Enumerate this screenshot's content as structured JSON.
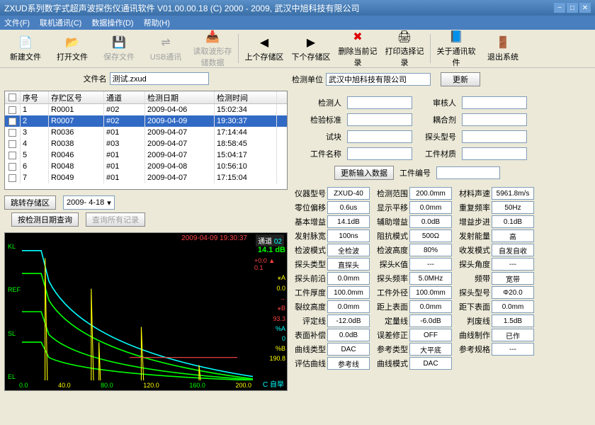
{
  "title": "ZXUD系列数字式超声波探伤仪通讯软件 V01.00.00.18 (C) 2000 - 2009, 武汉中旭科技有限公司",
  "menu": {
    "file": "文件(F)",
    "comm": "联机通讯(C)",
    "data": "数据操作(D)",
    "help": "帮助(H)"
  },
  "toolbar": {
    "new": "新建文件",
    "open": "打开文件",
    "save": "保存文件",
    "usb": "USB通讯",
    "read": "读取波形存储数据",
    "prev": "上个存储区",
    "next": "下个存储区",
    "delete": "删除当前记录",
    "print": "打印选择记录",
    "about": "关于通讯软件",
    "exit": "退出系统"
  },
  "file": {
    "label": "文件名",
    "value": "测试.zxud"
  },
  "unit": {
    "label": "检测单位",
    "value": "武汉中旭科技有限公司",
    "update": "更新"
  },
  "table": {
    "headers": [
      "",
      "序号",
      "存贮区号",
      "通道",
      "检测日期",
      "检测时间"
    ],
    "rows": [
      [
        "1",
        "R0001",
        "#02",
        "2009-04-06",
        "15:02:34"
      ],
      [
        "2",
        "R0007",
        "#02",
        "2009-04-09",
        "19:30:37"
      ],
      [
        "3",
        "R0036",
        "#01",
        "2009-04-07",
        "17:14:44"
      ],
      [
        "4",
        "R0038",
        "#03",
        "2009-04-07",
        "18:58:45"
      ],
      [
        "5",
        "R0046",
        "#01",
        "2009-04-07",
        "15:04:17"
      ],
      [
        "6",
        "R0048",
        "#01",
        "2009-04-08",
        "10:56:10"
      ],
      [
        "7",
        "R0049",
        "#01",
        "2009-04-07",
        "17:15:04"
      ]
    ],
    "selected": 1
  },
  "controls": {
    "jump": "跳转存储区",
    "date": "2009- 4-18",
    "byDate": "按检测日期查询",
    "all": "查询所有记录"
  },
  "chart_data": {
    "type": "line",
    "timestamp": "2009-04-09 19:30:37",
    "channel_label": "通道",
    "channel": "02",
    "db": "14.1 dB",
    "offset": "+0.0 ▲ 0.1",
    "xA": "⚹A",
    "xA_val": "0.0",
    "xB": "⚹B",
    "xB_val": "93.3",
    "pctA": "%A",
    "pctA_val": "0",
    "pctB": "%B",
    "pctB_val": "190.8",
    "y_labels": [
      "KL",
      "REF",
      "SL",
      "EL"
    ],
    "x_ticks": [
      "0.0",
      "40.0",
      "80.0",
      "120.0",
      "160.0",
      "200.0"
    ],
    "footer": "C 自举"
  },
  "inputs": {
    "rows": [
      {
        "l1": "检测人",
        "v1": "",
        "l2": "审核人",
        "v2": ""
      },
      {
        "l1": "检验标准",
        "v1": "",
        "l2": "耦合剂",
        "v2": ""
      },
      {
        "l1": "试块",
        "v1": "",
        "l2": "探头型号",
        "v2": ""
      },
      {
        "l1": "工件名称",
        "v1": "",
        "l2": "工件材质",
        "v2": ""
      }
    ],
    "update": "更新输入数据",
    "serial_lbl": "工件编号",
    "serial": ""
  },
  "params": [
    [
      "仪器型号",
      "ZXUD-40",
      "检测范围",
      "200.0mm",
      "材料声速",
      "5961.8m/s"
    ],
    [
      "零位偏移",
      "0.6us",
      "显示平移",
      "0.0mm",
      "重复频率",
      "50Hz"
    ],
    [
      "基本增益",
      "14.1dB",
      "辅助增益",
      "0.0dB",
      "增益步进",
      "0.1dB"
    ],
    [
      "发射脉宽",
      "100ns",
      "阻抗模式",
      "500Ω",
      "发射能量",
      "高"
    ],
    [
      "检波模式",
      "全检波",
      "检波高度",
      "80%",
      "收发模式",
      "自发自收"
    ],
    [
      "探头类型",
      "直探头",
      "探头K值",
      "---",
      "探头角度",
      "---"
    ],
    [
      "探头前沿",
      "0.0mm",
      "探头频率",
      "5.0MHz",
      "频带",
      "宽带"
    ],
    [
      "工件厚度",
      "100.0mm",
      "工件外径",
      "100.0mm",
      "探头型号",
      "Φ20.0"
    ],
    [
      "裂纹高度",
      "0.0mm",
      "距上表面",
      "0.0mm",
      "距下表面",
      "0.0mm"
    ],
    [
      "评定线",
      "-12.0dB",
      "定量线",
      "-6.0dB",
      "判废线",
      "1.5dB"
    ],
    [
      "表面补偿",
      "0.0dB",
      "误差修正",
      "OFF",
      "曲线制作",
      "已作"
    ],
    [
      "曲线类型",
      "DAC",
      "参考类型",
      "大平底",
      "参考规格",
      "---"
    ],
    [
      "评估曲线",
      "参考线",
      "曲线模式",
      "DAC",
      "",
      ""
    ]
  ]
}
